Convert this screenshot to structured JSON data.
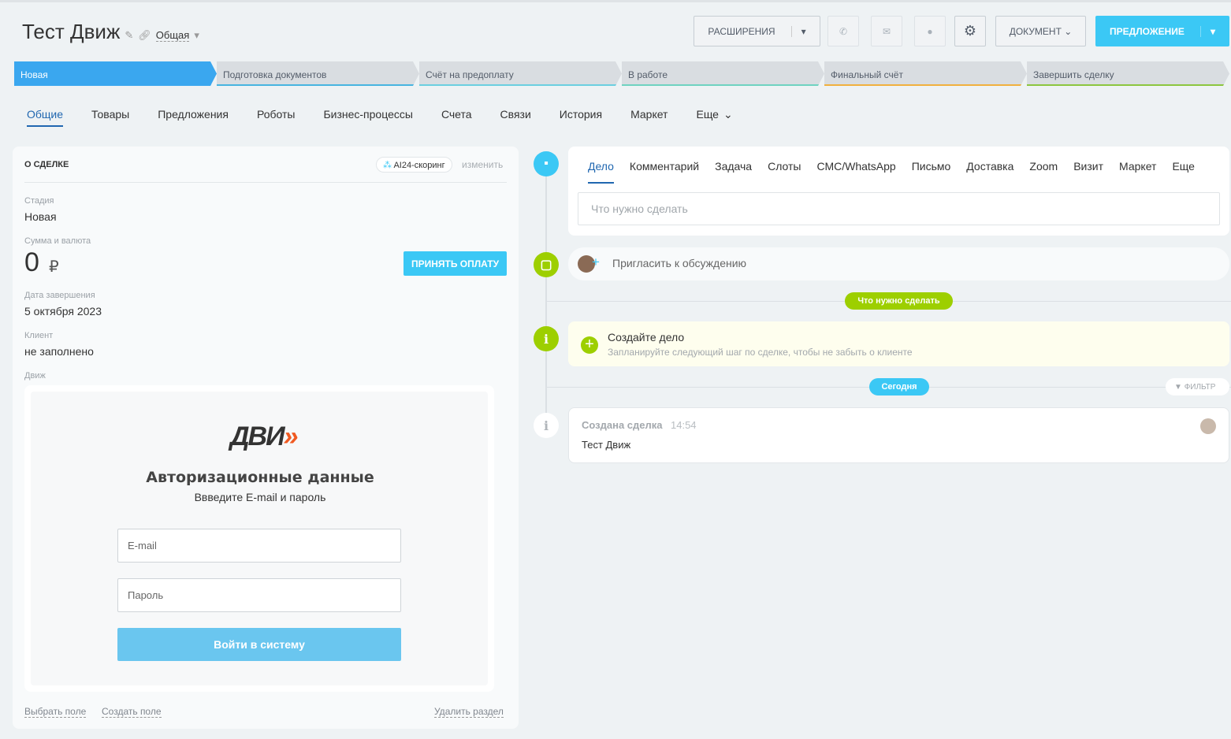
{
  "header": {
    "title": "Тест Движ",
    "category": "Общая",
    "buttons": {
      "extensions": "РАСШИРЕНИЯ",
      "document": "ДОКУМЕНТ",
      "offer": "ПРЕДЛОЖЕНИЕ"
    }
  },
  "stages": [
    {
      "label": "Новая",
      "color": "#3aa7ef",
      "active": true
    },
    {
      "label": "Подготовка документов",
      "color": "#47b4e0"
    },
    {
      "label": "Счёт на предоплату",
      "color": "#6bcfe0"
    },
    {
      "label": "В работе",
      "color": "#6fd3c0"
    },
    {
      "label": "Финальный счёт",
      "color": "#f0b03e"
    },
    {
      "label": "Завершить сделку",
      "color": "#8cc63f"
    }
  ],
  "tabs": [
    "Общие",
    "Товары",
    "Предложения",
    "Роботы",
    "Бизнес-процессы",
    "Счета",
    "Связи",
    "История",
    "Маркет",
    "Еще"
  ],
  "deal": {
    "heading": "О СДЕЛКЕ",
    "scoring": "AI24-скоринг",
    "edit": "изменить",
    "fields": {
      "stage_label": "Стадия",
      "stage": "Новая",
      "sum_label": "Сумма и валюта",
      "sum": "0",
      "currency": "₽",
      "pay_button": "ПРИНЯТЬ ОПЛАТУ",
      "date_label": "Дата завершения",
      "date": "5 октября 2023",
      "client_label": "Клиент",
      "client": "не заполнено",
      "app_label": "Движ"
    },
    "widget": {
      "logo": "ДВИ",
      "title": "Авторизационные данные",
      "subtitle": "Ввведите E-mail и пароль",
      "email_placeholder": "E-mail",
      "password_placeholder": "Пароль",
      "login": "Войти в систему"
    },
    "footer": {
      "select_field": "Выбрать поле",
      "create_field": "Создать поле",
      "delete_section": "Удалить раздел"
    }
  },
  "timeline": {
    "tabs": [
      "Дело",
      "Комментарий",
      "Задача",
      "Слоты",
      "СМС/WhatsApp",
      "Письмо",
      "Доставка",
      "Zoom",
      "Визит",
      "Маркет",
      "Еще"
    ],
    "todo_placeholder": "Что нужно сделать",
    "invite": "Пригласить к обсуждению",
    "todo_pill": "Что нужно сделать",
    "create_title": "Создайте дело",
    "create_sub": "Запланируйте следующий шаг по сделке, чтобы не забыть о клиенте",
    "today": "Сегодня",
    "filter": "ФИЛЬТР",
    "event_title": "Создана сделка",
    "event_time": "14:54",
    "event_text": "Тест Движ"
  }
}
